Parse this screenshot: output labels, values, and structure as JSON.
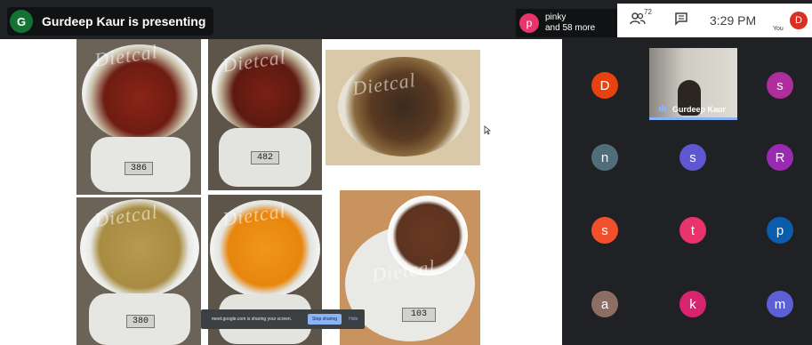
{
  "topbar": {
    "presenter_initial": "G",
    "presenter_text": "Gurdeep Kaur is presenting",
    "viewer_initial": "p",
    "viewer_name": "pinky",
    "viewer_more": "and 58 more",
    "participant_count": "72",
    "time": "3:29 PM",
    "self_initial": "D",
    "self_label": "You"
  },
  "shared_screen": {
    "watermark": "Dietcal",
    "scale_readings": [
      "386",
      "482",
      "380",
      "103"
    ],
    "share_bar": {
      "message": "meet.google.com is sharing your screen.",
      "stop_label": "Stop sharing",
      "hide_label": "Hide"
    }
  },
  "participants": {
    "video_name": "Gurdeep Kaur",
    "tiles": [
      {
        "initial": "D",
        "color": "#e8430e"
      },
      {
        "initial": "s",
        "color": "#b02d9e"
      },
      {
        "initial": "n",
        "color": "#4f6e79"
      },
      {
        "initial": "s",
        "color": "#5e57d1"
      },
      {
        "initial": "R",
        "color": "#9a2bb0"
      },
      {
        "initial": "s",
        "color": "#f0502a"
      },
      {
        "initial": "t",
        "color": "#e8336d"
      },
      {
        "initial": "p",
        "color": "#0b5cab"
      },
      {
        "initial": "a",
        "color": "#8d6e63"
      },
      {
        "initial": "k",
        "color": "#d6246e"
      },
      {
        "initial": "m",
        "color": "#5c5fd6"
      }
    ]
  },
  "icons": {
    "people": "people-icon",
    "chat": "chat-icon"
  }
}
